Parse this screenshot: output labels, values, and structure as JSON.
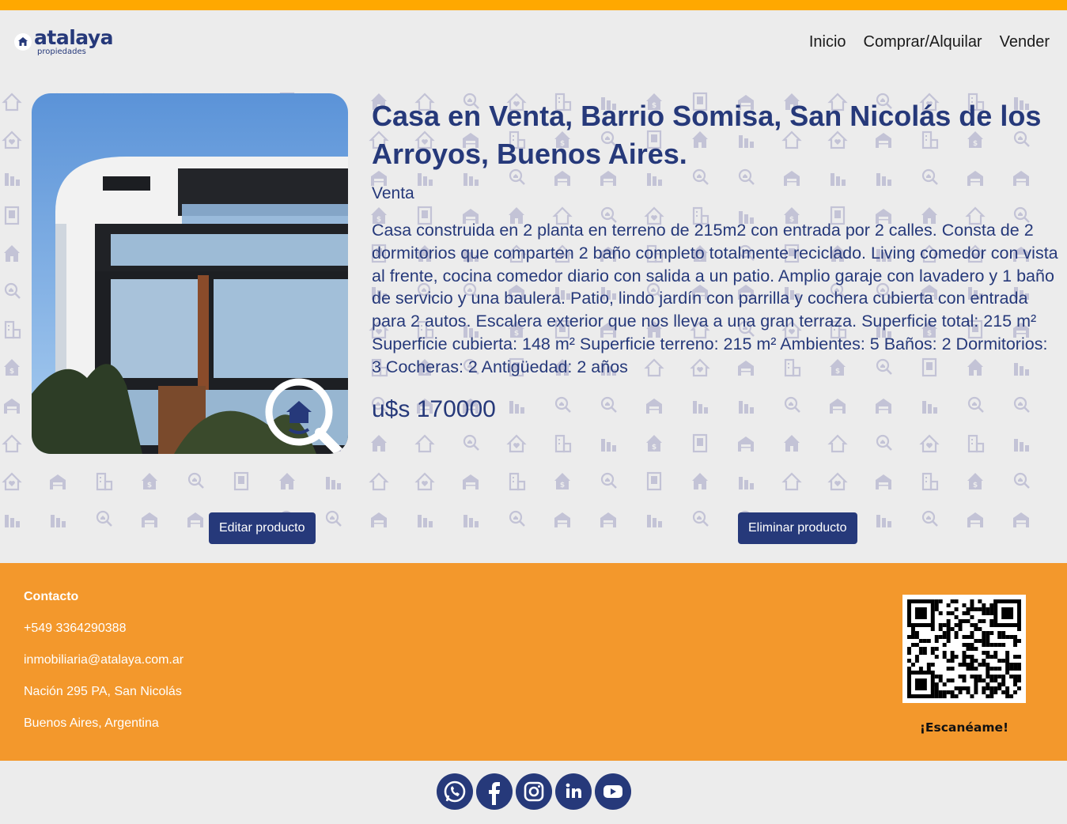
{
  "brand": {
    "name": "atalaya",
    "tagline": "propiedades",
    "accent": "#ffa800",
    "primary": "#26397a",
    "footer_bg": "#f3982c"
  },
  "nav": {
    "items": [
      "Inicio",
      "Comprar/Alquilar",
      "Vender"
    ]
  },
  "property": {
    "title": "Casa en Venta, Barrio Somisa, San Nicolás de los Arroyos, Buenos Aires.",
    "operation": "Venta",
    "description_text": "Casa construida en 2 planta en terreno de 215m2 con entrada por 2 calles. Consta de 2 dormitorios que comparten 2 baño completo totalmente reciclado. Living comedor con vista al frente, cocina comedor diario con salida a un patio. Amplio garaje con lavadero y 1 baño de servicio y una baulera. Patio, lindo jardín con parrilla y cochera cubierta con entrada para 2 autos. Escalera exterior que nos lleva a una gran terraza. Superficie total: 215 m² Superficie cubierta: 148 m² Superficie terreno: 215 m² Ambientes: 5 Baños: 2 Dormitorios: 3 Cocheras: 2 Antigüedad: 2 años",
    "price": "u$s 170000",
    "image_icon": "house-search-icon"
  },
  "actions": {
    "edit_label": "Editar producto",
    "delete_label": "Eliminar producto"
  },
  "footer": {
    "contact_title": "Contacto",
    "phone": "+549 3364290388",
    "email": "inmobiliaria@atalaya.com.ar",
    "address_line1": "Nación 295 PA, San Nicolás",
    "address_line2": "Buenos Aires, Argentina",
    "qr_label": "¡Escanéame!"
  },
  "social": [
    "whatsapp-icon",
    "facebook-icon",
    "instagram-icon",
    "linkedin-icon",
    "youtube-icon"
  ]
}
